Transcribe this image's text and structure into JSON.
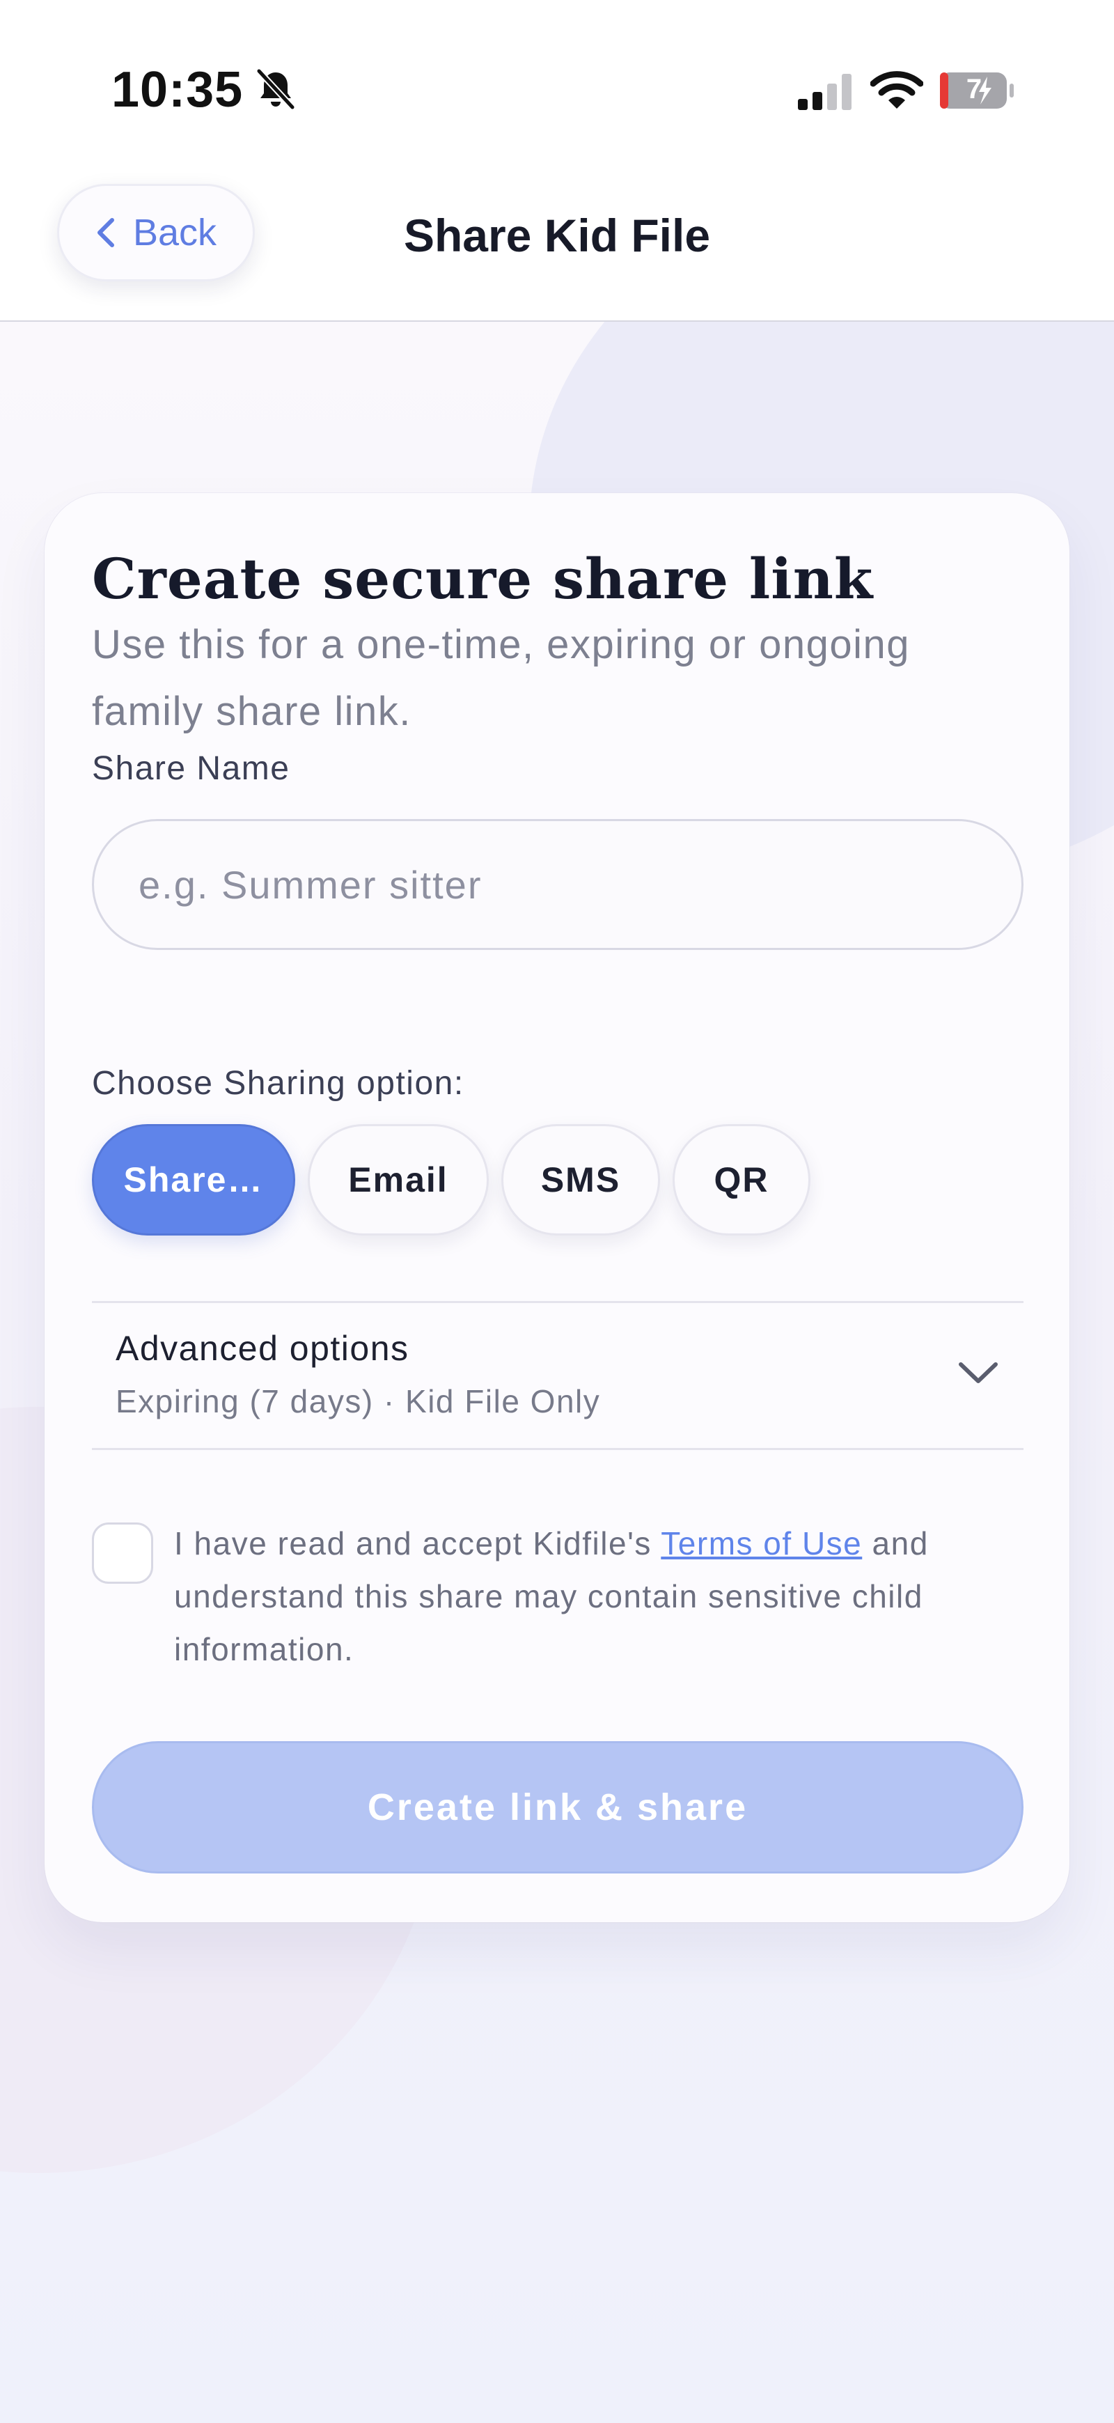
{
  "status_bar": {
    "time": "10:35",
    "battery": "7",
    "icons": [
      "bell-slash-icon",
      "signal-icon",
      "wifi-icon",
      "battery-icon"
    ]
  },
  "nav": {
    "back_label": "Back",
    "title": "Share Kid File"
  },
  "card": {
    "title": "Create secure share link",
    "subtitle": "Use this for a one-time, expiring or ongoing family share link."
  },
  "share_name": {
    "label": "Share Name",
    "placeholder": "e.g. Summer sitter",
    "value": ""
  },
  "sharing": {
    "label": "Choose Sharing option:",
    "options": [
      {
        "label": "Share…",
        "selected": true
      },
      {
        "label": "Email",
        "selected": false
      },
      {
        "label": "SMS",
        "selected": false
      },
      {
        "label": "QR",
        "selected": false
      }
    ]
  },
  "advanced": {
    "title": "Advanced options",
    "summary": "Expiring (7 days) · Kid File Only"
  },
  "terms": {
    "checked": false,
    "text_before": "I have read and accept Kidfile's ",
    "link_label": "Terms of Use",
    "text_after": " and understand this share may contain sensitive child information."
  },
  "create_button": {
    "label": "Create link & share",
    "enabled": false
  },
  "colors": {
    "accent": "#5f84ea",
    "accent_disabled": "#b5c5f4",
    "title_text": "#161a2b",
    "muted_text": "#7d8090"
  }
}
